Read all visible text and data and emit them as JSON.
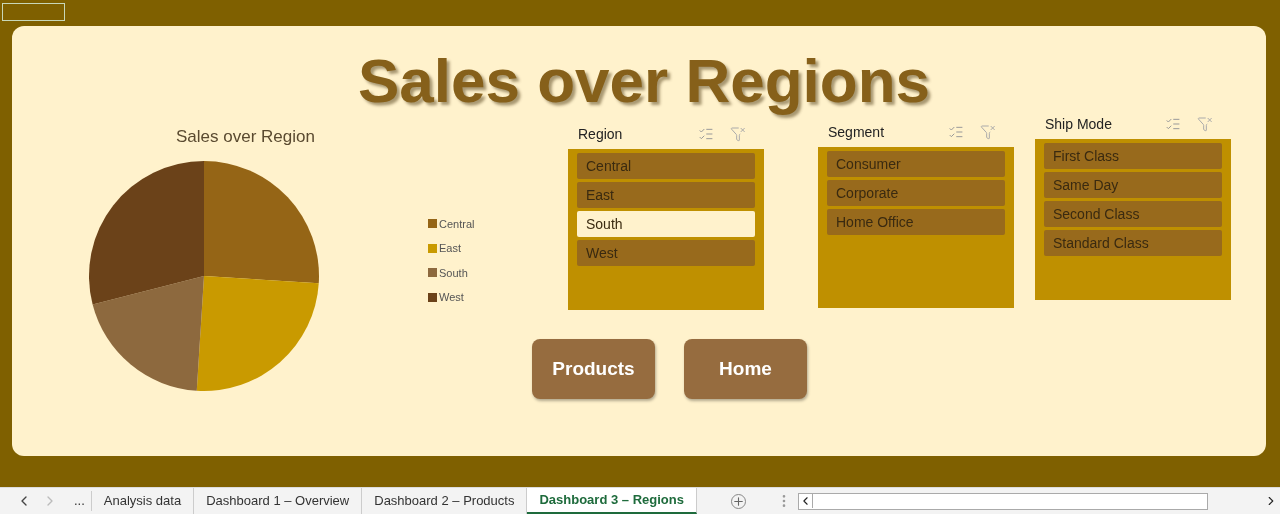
{
  "title": "Sales over Regions",
  "chart": {
    "title": "Sales over Region",
    "legend": [
      {
        "label": "Central",
        "color": "#956516"
      },
      {
        "label": "East",
        "color": "#c99a00"
      },
      {
        "label": "South",
        "color": "#8d693e"
      },
      {
        "label": "West",
        "color": "#6b4219"
      }
    ]
  },
  "slicers": [
    {
      "header": "Region",
      "items": [
        {
          "label": "Central",
          "selected": true
        },
        {
          "label": "East",
          "selected": true
        },
        {
          "label": "South",
          "selected": false
        },
        {
          "label": "West",
          "selected": true
        }
      ]
    },
    {
      "header": "Segment",
      "items": [
        {
          "label": "Consumer",
          "selected": true
        },
        {
          "label": "Corporate",
          "selected": true
        },
        {
          "label": "Home Office",
          "selected": true
        }
      ]
    },
    {
      "header": "Ship Mode",
      "items": [
        {
          "label": "First Class",
          "selected": true
        },
        {
          "label": "Same Day",
          "selected": true
        },
        {
          "label": "Second Class",
          "selected": true
        },
        {
          "label": "Standard Class",
          "selected": true
        }
      ]
    }
  ],
  "buttons": [
    "Products",
    "Home"
  ],
  "sheet_bar": {
    "more": "...",
    "tabs": [
      {
        "label": "Analysis data",
        "selected": false
      },
      {
        "label": "Dashboard 1 – Overview",
        "selected": false
      },
      {
        "label": "Dashboard 2 – Products",
        "selected": false
      },
      {
        "label": "Dashboard 3 – Regions",
        "selected": true
      }
    ]
  }
}
